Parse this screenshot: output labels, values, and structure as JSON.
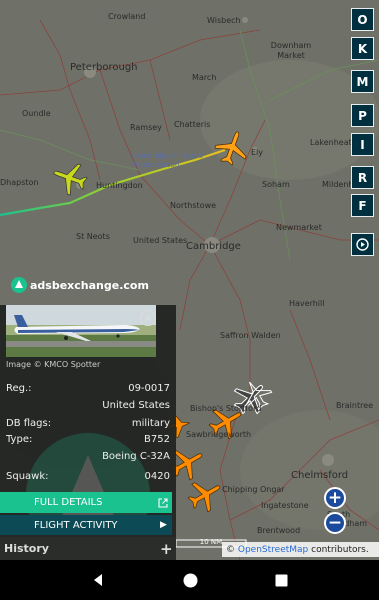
{
  "map": {
    "places": [
      {
        "key": "crowland",
        "text": "Crowland"
      },
      {
        "key": "wisbech",
        "text": "Wisbech"
      },
      {
        "key": "peterborough",
        "text": "Peterborough"
      },
      {
        "key": "downham",
        "text": "Downham Market"
      },
      {
        "key": "march",
        "text": "March"
      },
      {
        "key": "oundle",
        "text": "Oundle"
      },
      {
        "key": "ramsey",
        "text": "Ramsey"
      },
      {
        "key": "chatteris",
        "text": "Chatteris"
      },
      {
        "key": "ely",
        "text": "Ely"
      },
      {
        "key": "lakenheath",
        "text": "Lakenheath"
      },
      {
        "key": "cambs",
        "text": "Cambridgeshire and Peterborough"
      },
      {
        "key": "dhapston",
        "text": "Dhapston"
      },
      {
        "key": "huntingdon",
        "text": "Huntingdon"
      },
      {
        "key": "soham",
        "text": "Soham"
      },
      {
        "key": "mildenhall",
        "text": "Mildenhall"
      },
      {
        "key": "northstowe",
        "text": "Northstowe"
      },
      {
        "key": "stneots",
        "text": "St Neots"
      },
      {
        "key": "unitedstates",
        "text": "United States"
      },
      {
        "key": "newmarket",
        "text": "Newmarket"
      },
      {
        "key": "cambridge",
        "text": "Cambridge"
      },
      {
        "key": "haverhill",
        "text": "Haverhill"
      },
      {
        "key": "saffron",
        "text": "Saffron Walden"
      },
      {
        "key": "bishops",
        "text": "Bishop's Stortford"
      },
      {
        "key": "sawbridgeworth",
        "text": "Sawbridgeworth"
      },
      {
        "key": "braintree",
        "text": "Braintree"
      },
      {
        "key": "chelmsford",
        "text": "Chelmsford"
      },
      {
        "key": "ingatestone",
        "text": "Ingatestone"
      },
      {
        "key": "chippingongar",
        "text": "Chipping Ongar"
      },
      {
        "key": "brentwood",
        "text": "Brentwood"
      },
      {
        "key": "southwoodham",
        "text": "South Woodham"
      }
    ],
    "watermark": "adsbexchange.com",
    "scale_label": "10 NM",
    "attribution_prefix": "©",
    "attribution_link": "OpenStreetMap",
    "attribution_suffix": "contributors."
  },
  "right_toolbar": {
    "buttons": [
      "O",
      "K",
      "M",
      "P",
      "I",
      "R",
      "F"
    ]
  },
  "panel": {
    "image_caption": "Image © KMCO Spotter",
    "rows": {
      "reg_label": "Reg.:",
      "reg_value": "09-0017",
      "country_value": "United States",
      "dbflags_label": "DB flags:",
      "dbflags_value": "military",
      "type_label": "Type:",
      "type_value": "B752",
      "model_value": "Boeing C-32A",
      "squawk_label": "Squawk:",
      "squawk_value": "0420"
    },
    "full_details_label": "FULL DETAILS",
    "flight_activity_label": "FLIGHT ACTIVITY",
    "history_label": "History"
  },
  "colors": {
    "accent_green": "#19c28e",
    "button_dark": "#0c4a55",
    "toolbar_bg": "#002f3f",
    "zoom_blue": "#1c4a9c",
    "selected_plane": "#c7d81d",
    "orange_plane": "#ff8c00"
  }
}
